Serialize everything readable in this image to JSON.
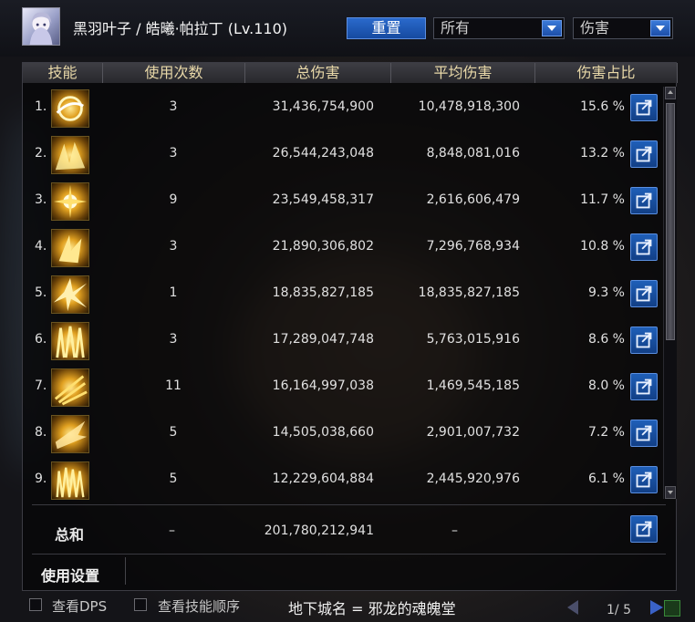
{
  "header": {
    "character_name": "黑羽叶子 / 皓曦·帕拉丁 (Lv.110)",
    "reset_label": "重置",
    "filter_select": "所有",
    "type_select": "伤害"
  },
  "columns": {
    "skill": "技能",
    "count": "使用次数",
    "total": "总伤害",
    "average": "平均伤害",
    "ratio": "伤害占比"
  },
  "rows": [
    {
      "rank": "1.",
      "count": "3",
      "total": "31,436,754,900",
      "average": "10,478,918,300",
      "ratio": "15.6 %"
    },
    {
      "rank": "2.",
      "count": "3",
      "total": "26,544,243,048",
      "average": "8,848,081,016",
      "ratio": "13.2 %"
    },
    {
      "rank": "3.",
      "count": "9",
      "total": "23,549,458,317",
      "average": "2,616,606,479",
      "ratio": "11.7 %"
    },
    {
      "rank": "4.",
      "count": "3",
      "total": "21,890,306,802",
      "average": "7,296,768,934",
      "ratio": "10.8 %"
    },
    {
      "rank": "5.",
      "count": "1",
      "total": "18,835,827,185",
      "average": "18,835,827,185",
      "ratio": "9.3 %"
    },
    {
      "rank": "6.",
      "count": "3",
      "total": "17,289,047,748",
      "average": "5,763,015,916",
      "ratio": "8.6 %"
    },
    {
      "rank": "7.",
      "count": "11",
      "total": "16,164,997,038",
      "average": "1,469,545,185",
      "ratio": "8.0 %"
    },
    {
      "rank": "8.",
      "count": "5",
      "total": "14,505,038,660",
      "average": "2,901,007,732",
      "ratio": "7.2 %"
    },
    {
      "rank": "9.",
      "count": "5",
      "total": "12,229,604,884",
      "average": "2,445,920,976",
      "ratio": "6.1 %"
    }
  ],
  "totals": {
    "label": "总和",
    "count": "–",
    "total": "201,780,212,941",
    "average": "–"
  },
  "settings_label": "使用设置",
  "footer": {
    "view_dps": "查看DPS",
    "view_order": "查看技能顺序",
    "dungeon": "地下城名 = 邪龙的魂魄堂",
    "page": "1/ 5"
  },
  "colors": {
    "accent_blue": "#1d5cc0",
    "header_text": "#e8d8a8",
    "skill_gold": "#e0a020"
  }
}
